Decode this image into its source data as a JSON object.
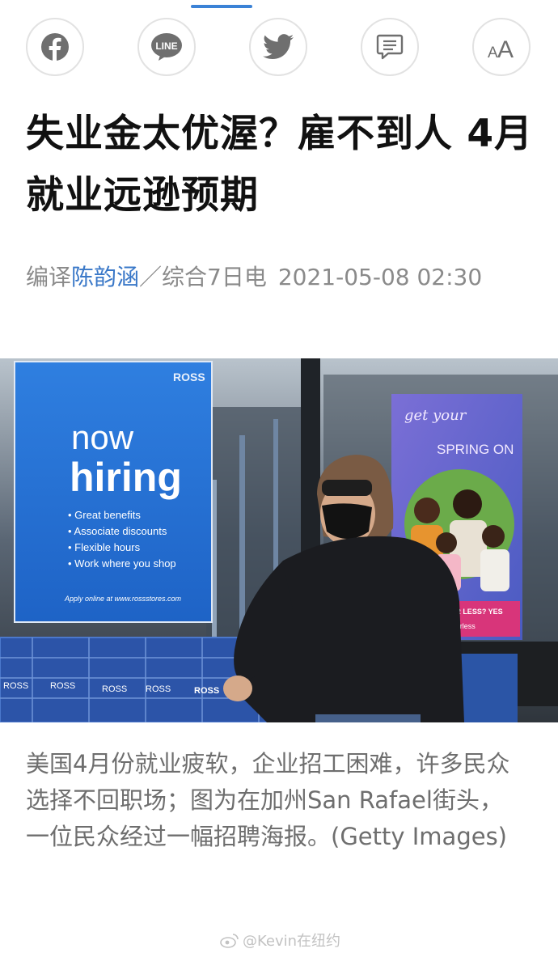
{
  "share_bar": {
    "buttons": [
      {
        "name": "facebook",
        "icon": "facebook-icon"
      },
      {
        "name": "line",
        "icon": "line-icon",
        "label": "LINE"
      },
      {
        "name": "twitter",
        "icon": "twitter-icon"
      },
      {
        "name": "comment",
        "icon": "comment-icon"
      },
      {
        "name": "font-size",
        "icon": "font-size-icon",
        "label": "AA"
      }
    ]
  },
  "article": {
    "headline": "失业金太优渥？雇不到人 4月就业远逊预期",
    "byline": {
      "prefix": "编译",
      "author": "陈韵涵",
      "source": "／综合7日电",
      "date": "2021-05-08 02:30"
    },
    "photo": {
      "poster_left": {
        "brand": "ROSS",
        "title_line1": "now",
        "title_line2": "hiring",
        "bullets": [
          "• Great benefits",
          "• Associate discounts",
          "• Flexible hours",
          "• Work where you shop"
        ],
        "footer": "Apply online at www.rossstores.com"
      },
      "poster_right": {
        "line1": "get your",
        "line2": "SPRING ON",
        "footer": "FASHION FOR LESS? YES",
        "tag": "#yesforless"
      },
      "cart_brand": "ROSS"
    },
    "caption": "美国4月份就业疲软，企业招工困难，许多民众选择不回职场；图为在加州San Rafael街头，一位民众经过一幅招聘海报。(Getty Images)"
  },
  "watermark": {
    "text": "@Kevin在纽约",
    "icon": "weibo-icon"
  },
  "colors": {
    "accent": "#3a78c8",
    "headline": "#111111",
    "meta": "#8a8a8a",
    "caption": "#6e6e6e"
  }
}
